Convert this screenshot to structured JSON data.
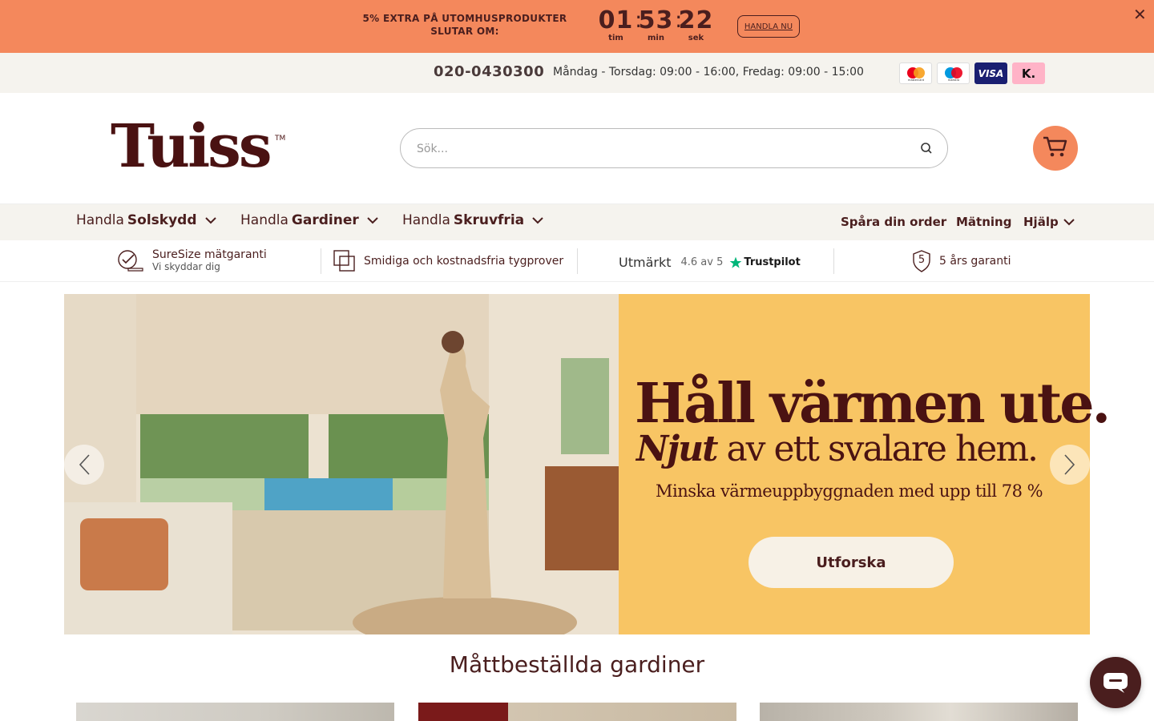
{
  "promo": {
    "text": "5% EXTRA PÅ UTOMHUSPRODUKTER SLUTAR OM:",
    "timer": {
      "hours": "01",
      "minutes": "53",
      "seconds": "22",
      "hours_label": "tim",
      "minutes_label": "min",
      "seconds_label": "sek"
    },
    "cta_label": "HANDLA NU",
    "background": "#f4885c"
  },
  "infobar": {
    "phone": "020-0430300",
    "hours": "Måndag - Torsdag: 09:00 - 16:00, Fredag: 09:00 - 15:00",
    "payment_methods": [
      {
        "name": "mastercard",
        "label": "mastercard"
      },
      {
        "name": "maestro",
        "label": "maestro"
      },
      {
        "name": "visa",
        "label": "VISA"
      },
      {
        "name": "klarna",
        "label": "K."
      }
    ]
  },
  "header": {
    "logo": "Tuiss",
    "trademark": "TM",
    "search_placeholder": "Sök..."
  },
  "nav": {
    "items": [
      {
        "prefix": "Handla",
        "label": "Solskydd"
      },
      {
        "prefix": "Handla",
        "label": "Gardiner"
      },
      {
        "prefix": "Handla",
        "label": "Skruvfria"
      }
    ],
    "right": {
      "track": "Spåra din order",
      "measure": "Mätning",
      "help": "Hjälp"
    }
  },
  "usp": {
    "suresize_title": "SureSize mätgaranti",
    "suresize_sub": "Vi skyddar dig",
    "samples": "Smidiga och kostnadsfria tygprover",
    "trustpilot_rating_word": "Utmärkt",
    "trustpilot_score": "4.6 av 5",
    "trustpilot_brand": "Trustpilot",
    "warranty_number": "5",
    "warranty": "5 års garanti"
  },
  "hero": {
    "headline": "Håll värmen ute.",
    "sub_italic": "Njut",
    "sub_rest": " av ett svalare hem.",
    "tagline": "Minska värmeuppbyggnaden med upp till 78 %",
    "cta": "Utforska",
    "panel_color": "#f8c564"
  },
  "section": {
    "title": "Måttbeställda gardiner"
  }
}
